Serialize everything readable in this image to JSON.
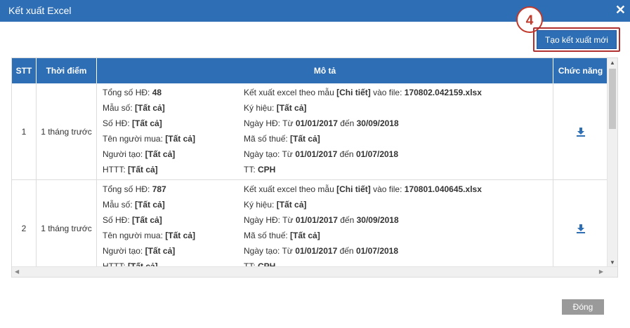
{
  "dialog": {
    "title": "Kết xuất Excel",
    "close_symbol": "✕",
    "step_number": "4",
    "new_export_label": "Tạo kết xuất mới",
    "close_label": "Đóng"
  },
  "table": {
    "headers": [
      "STT",
      "Thời điểm",
      "Mô tả",
      "Chức năng"
    ],
    "rows": [
      {
        "stt": "1",
        "time": "1 tháng trước",
        "left": [
          {
            "label": "Tổng số HĐ: ",
            "value": "48"
          },
          {
            "label": "Mẫu số: ",
            "value": "[Tất cả]"
          },
          {
            "label": "Số HĐ: ",
            "value": "[Tất cả]"
          },
          {
            "label": "Tên người mua: ",
            "value": "[Tất cả]"
          },
          {
            "label": "Người tạo: ",
            "value": "[Tất cả]"
          },
          {
            "label": "HTTT: ",
            "value": "[Tất cả]"
          }
        ],
        "right": [
          {
            "label": "Kết xuất excel theo mẫu ",
            "value": "[Chi tiết]",
            "label2": " vào file: ",
            "value2": "170802.042159.xlsx"
          },
          {
            "label": "Ký hiệu: ",
            "value": "[Tất cả]"
          },
          {
            "label": "Ngày HĐ:  Từ ",
            "value": "01/01/2017",
            "label2": " đến ",
            "value2": "30/09/2018"
          },
          {
            "label": "Mã số thuế: ",
            "value": "[Tất cả]"
          },
          {
            "label": "Ngày tạo: Từ ",
            "value": "01/01/2017",
            "label2": " đến ",
            "value2": "01/07/2018"
          },
          {
            "label": "TT: ",
            "value": "CPH"
          }
        ],
        "action_icon": "download-icon"
      },
      {
        "stt": "2",
        "time": "1 tháng trước",
        "left": [
          {
            "label": "Tổng số HĐ: ",
            "value": "787"
          },
          {
            "label": "Mẫu số: ",
            "value": "[Tất cả]"
          },
          {
            "label": "Số HĐ: ",
            "value": "[Tất cả]"
          },
          {
            "label": "Tên người mua: ",
            "value": "[Tất cả]"
          },
          {
            "label": "Người tạo: ",
            "value": "[Tất cả]"
          },
          {
            "label": "HTTT: ",
            "value": "[Tất cả]"
          }
        ],
        "right": [
          {
            "label": "Kết xuất excel theo mẫu ",
            "value": "[Chi tiết]",
            "label2": " vào file: ",
            "value2": "170801.040645.xlsx"
          },
          {
            "label": "Ký hiệu: ",
            "value": "[Tất cả]"
          },
          {
            "label": "Ngày HĐ:  Từ ",
            "value": "01/01/2017",
            "label2": " đến ",
            "value2": "30/09/2018"
          },
          {
            "label": "Mã số thuế: ",
            "value": "[Tất cả]"
          },
          {
            "label": "Ngày tạo: Từ ",
            "value": "01/01/2017",
            "label2": " đến ",
            "value2": "01/07/2018"
          },
          {
            "label": "TT: ",
            "value": "CPH"
          }
        ],
        "action_icon": "download-icon"
      }
    ]
  },
  "colors": {
    "primary": "#2e6eb5",
    "highlight": "#c0392b",
    "close_button": "#9a9a9a"
  }
}
